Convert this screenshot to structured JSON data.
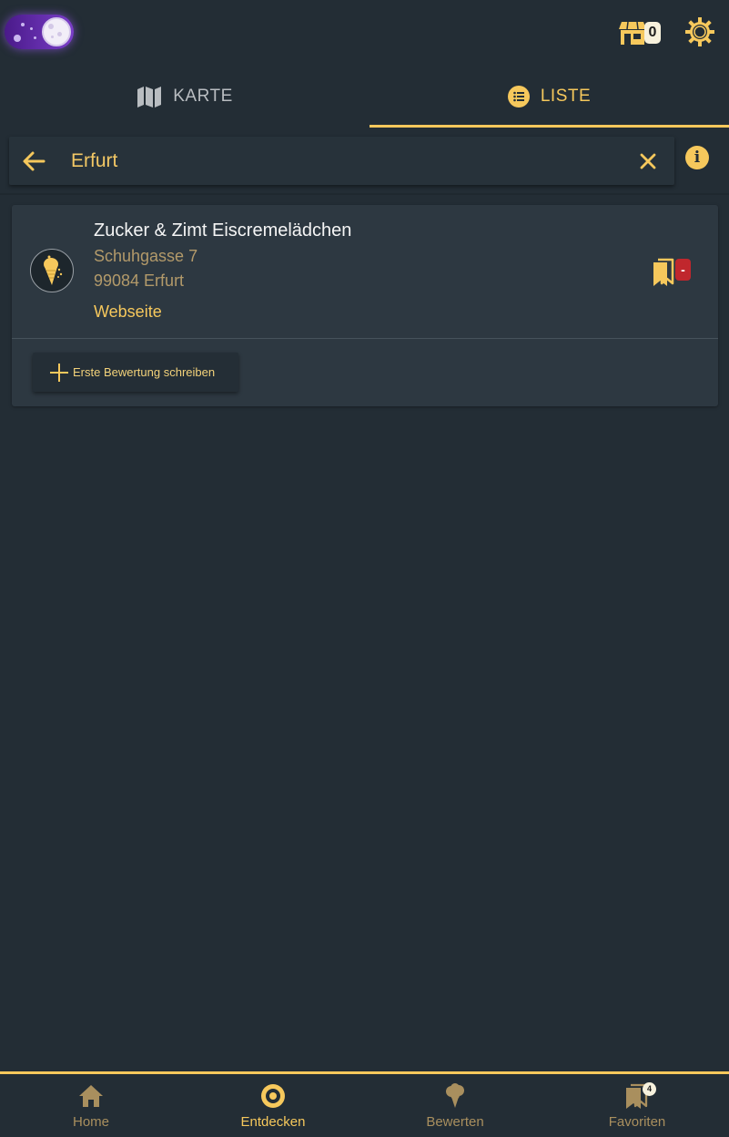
{
  "header": {
    "shop_count": "0"
  },
  "tabs": [
    {
      "label": "KARTE"
    },
    {
      "label": "LISTE"
    }
  ],
  "search": {
    "value": "Erfurt"
  },
  "result": {
    "name": "Zucker & Zimt Eiscremelädchen",
    "street": "Schuhgasse 7",
    "city": "99084 Erfurt",
    "website_label": "Webseite",
    "favorite_badge": "-",
    "review_button_label": "Erste Bewertung schreiben"
  },
  "bottom_nav": {
    "items": [
      {
        "label": "Home",
        "icon": "home-icon"
      },
      {
        "label": "Entdecken",
        "icon": "discover-icon"
      },
      {
        "label": "Bewerten",
        "icon": "ice-cream-icon"
      },
      {
        "label": "Favoriten",
        "icon": "bookmark-icon"
      }
    ],
    "favorites_count": "4"
  },
  "colors": {
    "accent": "#f6c85c",
    "background": "#232d35",
    "card": "#2d3841",
    "badge_red": "#c0272d"
  }
}
